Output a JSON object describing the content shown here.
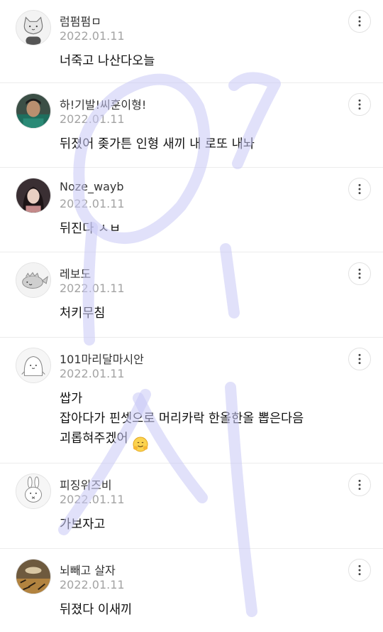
{
  "comments": [
    {
      "nickname": "럼펌펌ㅁ",
      "date": "2022.01.11",
      "text": "너죽고 나산다오늘",
      "avatar_icon": "white-cat-avatar-icon"
    },
    {
      "nickname": "하!기발!씨훈이형!",
      "date": "2022.01.11",
      "text": "뒤졌어 좆가튼 인형 새끼 내 로또 내놔",
      "avatar_icon": "person-photo-avatar-icon"
    },
    {
      "nickname": "Noze_wayb",
      "date": "2022.01.11",
      "text": "뒤진다 ㅅㅂ",
      "avatar_icon": "girl-photo-avatar-icon"
    },
    {
      "nickname": "레보도",
      "date": "2022.01.11",
      "text": "처키무침",
      "avatar_icon": "gray-whale-avatar-icon"
    },
    {
      "nickname": "101마리달마시안",
      "date": "2022.01.11",
      "text": "쌉가\n잡아다가 핀셋으로 머리카락 한올한올 뽑은다음\n괴롭혀주겠어",
      "avatar_icon": "white-blob-avatar-icon",
      "emoji": "hugging-face-emoji"
    },
    {
      "nickname": "피징위즈비",
      "date": "2022.01.11",
      "text": "가보자고",
      "avatar_icon": "white-rabbit-avatar-icon"
    },
    {
      "nickname": "뇌빼고 살자",
      "date": "2022.01.11",
      "text": "뒤졌다 이새끼",
      "avatar_icon": "tiger-photo-avatar-icon"
    }
  ],
  "more_icon": "more-vertical-icon",
  "colors": {
    "watermark": "#c9c9f5",
    "date": "#a3a3a3",
    "divider": "#ececec"
  }
}
